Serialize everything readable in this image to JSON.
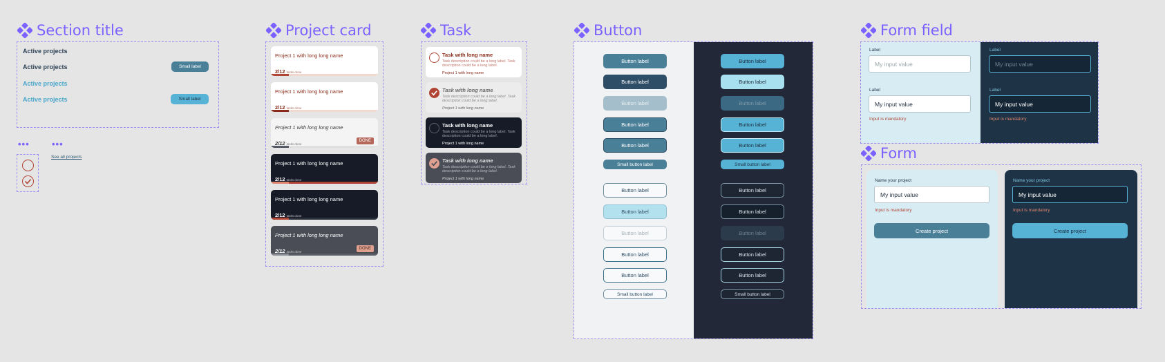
{
  "colors": {
    "accent": "#7b61ff",
    "dark_panel": "#1f2d3d",
    "button_primary_light": "#4a7f98",
    "button_primary_dark": "#56b3d6",
    "error": "#b04536",
    "project_name": "#8b2c1a"
  },
  "section_title": {
    "heading": "Section title",
    "rows": [
      {
        "label": "Active projects",
        "pill": ""
      },
      {
        "label": "Active projects",
        "pill": "Small label"
      },
      {
        "label": "Active projects",
        "pill": ""
      },
      {
        "label": "Active projects",
        "pill": "Small label"
      }
    ]
  },
  "misc": {
    "see_all": "See all projects",
    "checkbox_icons": [
      "circle-outline-icon",
      "check-circle-icon"
    ]
  },
  "project_card": {
    "heading": "Project card",
    "cards": [
      {
        "name": "Project 1 with long long name",
        "count": "2/12",
        "tasks_done": "tasks done",
        "done_badge": "",
        "progress": 0.17
      },
      {
        "name": "Project 1 with long long name",
        "count": "2/12",
        "tasks_done": "tasks done",
        "done_badge": "",
        "progress": 0.17
      },
      {
        "name": "Project 1 with long long name",
        "count": "2/12",
        "tasks_done": "tasks done",
        "done_badge": "DONE",
        "progress": 0.17
      },
      {
        "name": "Project 1 with long long name",
        "count": "2/12",
        "tasks_done": "tasks done",
        "done_badge": "",
        "progress": 0.17
      },
      {
        "name": "Project 1 with long long name",
        "count": "2/12",
        "tasks_done": "tasks done",
        "done_badge": "",
        "progress": 0.17
      },
      {
        "name": "Project 1 with long long name",
        "count": "2/12",
        "tasks_done": "tasks done",
        "done_badge": "DONE",
        "progress": 0.17
      }
    ]
  },
  "task": {
    "heading": "Task",
    "cards": [
      {
        "title": "Task with long name",
        "description": "Task description could be a long label. Task description could be a long label.",
        "project": "Project 1 with long name",
        "checked": false
      },
      {
        "title": "Task with long name",
        "description": "Task description could be a long label. Task description could be a long label.",
        "project": "Project 1 with long name",
        "checked": true
      },
      {
        "title": "Task with long name",
        "description": "Task description could be a long label. Task description could be a long label.",
        "project": "Project 1 with long name",
        "checked": false
      },
      {
        "title": "Task with long name",
        "description": "Task description could be a long label. Task description could be a long label.",
        "project": "Project 1 with long name",
        "checked": true
      }
    ]
  },
  "button": {
    "heading": "Button",
    "label": "Button label",
    "small_label": "Small button label"
  },
  "form_field": {
    "heading": "Form field",
    "label": "Label",
    "placeholder": "My input value",
    "value": "My input value",
    "error": "Input is mandatory"
  },
  "form": {
    "heading": "Form",
    "field_label": "Name your project",
    "value": "My input value",
    "error": "Input is mandatory",
    "submit": "Create project"
  }
}
